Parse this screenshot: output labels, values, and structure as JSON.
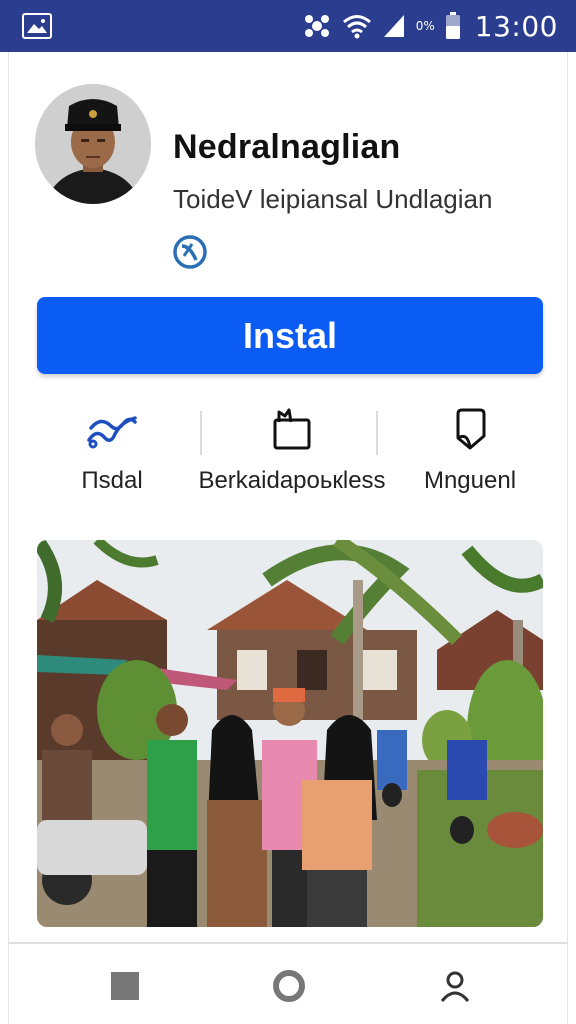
{
  "status_bar": {
    "battery_percent": "0%",
    "time": "13:00",
    "background_color": "#2b3d8f",
    "icons": [
      "gallery-icon",
      "bluetooth-icon",
      "wifi-icon",
      "signal-icon",
      "battery-icon"
    ]
  },
  "app": {
    "name": "Nedralnaglian",
    "subtitle": "ToideV leipiansal Undlagian",
    "verified_icon": "verified-badge-icon"
  },
  "install_button": {
    "label": "Instal",
    "color": "#0a5cf5"
  },
  "actions": [
    {
      "label": "Πsdal",
      "icon": "link-icon"
    },
    {
      "label": "Berkaidapoькless",
      "icon": "folder-icon"
    },
    {
      "label": "Mnguenl",
      "icon": "bookmark-icon"
    }
  ],
  "photo": {
    "subject": "photo-image"
  },
  "nav_bar": {
    "buttons": [
      "recents-button",
      "home-button",
      "profile-button"
    ]
  }
}
